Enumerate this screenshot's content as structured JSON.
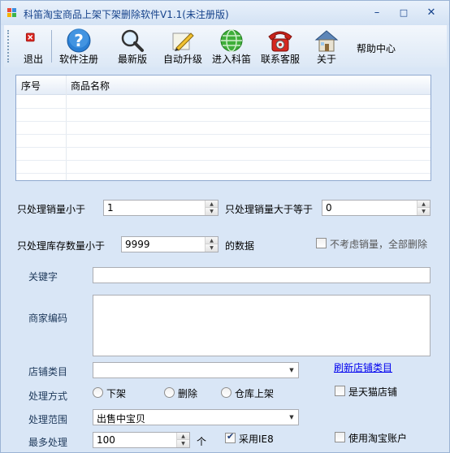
{
  "window": {
    "title": "科笛淘宝商品上架下架删除软件V1.1(未注册版)",
    "minimize": "–",
    "maximize": "□",
    "close": "✕"
  },
  "toolbar": {
    "items": [
      {
        "label": "退出",
        "icon": "exit-icon"
      },
      {
        "label": "软件注册",
        "icon": "help-icon"
      },
      {
        "label": "最新版",
        "icon": "magnifier-icon"
      },
      {
        "label": "自动升级",
        "icon": "pencil-icon"
      },
      {
        "label": "进入科笛",
        "icon": "globe-icon"
      },
      {
        "label": "联系客服",
        "icon": "telephone-icon"
      },
      {
        "label": "关于",
        "icon": "house-icon"
      }
    ],
    "help_center": "帮助中心"
  },
  "grid": {
    "columns": [
      "序号",
      "商品名称"
    ]
  },
  "form": {
    "sales_less_label": "只处理销量小于",
    "sales_less_value": "1",
    "sales_gte_label": "只处理销量大于等于",
    "sales_gte_value": "0",
    "stock_less_label": "只处理库存数量小于",
    "stock_less_value": "9999",
    "stock_suffix": "的数据",
    "ignore_sales_label": "不考虑销量，全部删除",
    "keyword_label": "关键字",
    "keyword_value": "",
    "merchant_code_label": "商家编码",
    "merchant_code_value": "",
    "shop_category_label": "店铺类目",
    "shop_category_value": "",
    "refresh_category_link": "刷新店铺类目",
    "method_label": "处理方式",
    "method_options": [
      "下架",
      "删除",
      "仓库上架"
    ],
    "tmall_label": "是天猫店铺",
    "scope_label": "处理范围",
    "scope_value": "出售中宝贝",
    "max_label": "最多处理",
    "max_value": "100",
    "max_unit": "个",
    "use_ie8_label": "采用IE8",
    "use_taobao_account_label": "使用淘宝账户"
  }
}
